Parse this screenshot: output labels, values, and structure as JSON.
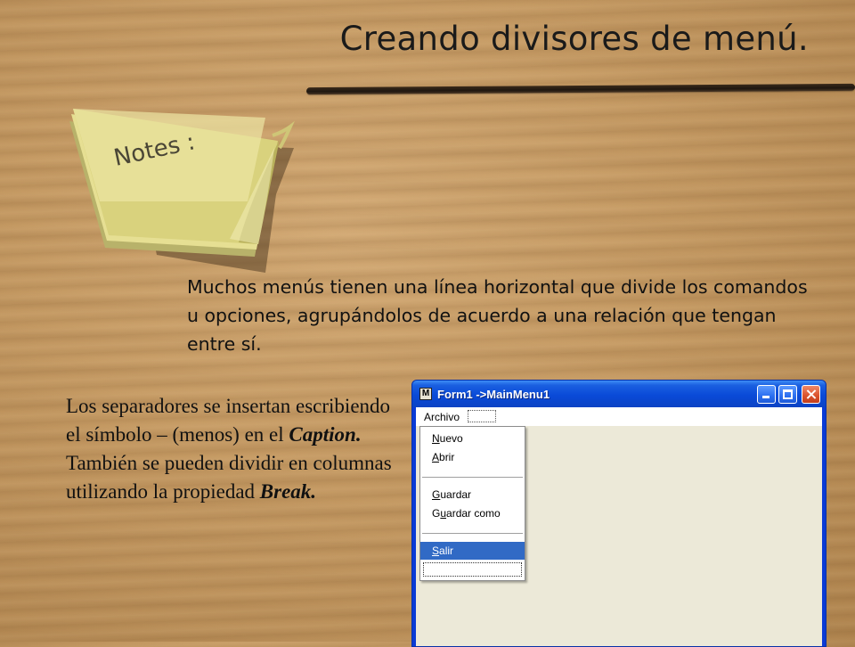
{
  "slide": {
    "title": "Creando divisores de menú.",
    "notes_label": "Notes :",
    "intro": "Muchos menús tienen una línea horizontal que divide los comandos u opciones, agrupándolos de acuerdo a una relación que tengan entre sí.",
    "side_text": {
      "part1": "Los separadores se insertan escribiendo el símbolo – (menos) en el ",
      "caption_word": "Caption.",
      "part2": " También se pueden dividir en columnas utilizando la propiedad ",
      "break_word": "Break."
    }
  },
  "window": {
    "icon_label": "M",
    "title": "Form1 ->MainMenu1",
    "menubar": {
      "archivo": "Archivo"
    },
    "menu_items": [
      {
        "mnemonic": "N",
        "rest": "uevo"
      },
      {
        "mnemonic": "A",
        "rest": "brir"
      },
      {
        "mnemonic": "G",
        "rest": "uardar"
      },
      {
        "prefix": "G",
        "mnemonic": "u",
        "rest": "ardar como"
      },
      {
        "mnemonic": "S",
        "rest": "alir"
      }
    ]
  },
  "colors": {
    "titlebar": "#0a4ad8",
    "menu_highlight": "#316ac5",
    "client_background": "#ece9d8"
  }
}
